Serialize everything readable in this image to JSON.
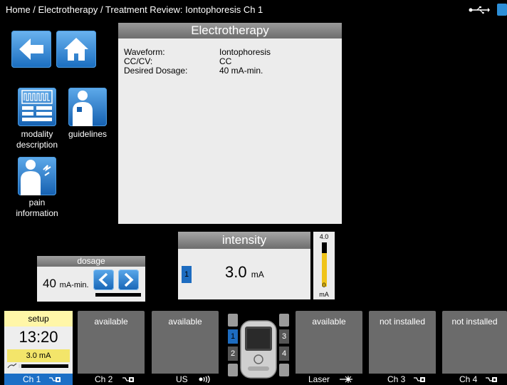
{
  "header": {
    "breadcrumb": "Home / Electrotherapy / Treatment Review: Iontophoresis Ch 1",
    "usb_icon": "usb-icon",
    "battery_icon": "battery-icon"
  },
  "nav": {
    "back_icon": "arrow-left-icon",
    "home_icon": "house-icon"
  },
  "tiles": [
    {
      "label_line1": "modality",
      "label_line2": "description",
      "icon": "waveform-icon"
    },
    {
      "label_line1": "guidelines",
      "label_line2": "",
      "icon": "body-electrode-icon"
    },
    {
      "label_line1": "pain",
      "label_line2": "information",
      "icon": "body-pain-icon"
    }
  ],
  "electrotherapy": {
    "title": "Electrotherapy",
    "params": [
      {
        "label": "Waveform:",
        "value": "Iontophoresis"
      },
      {
        "label": "CC/CV:",
        "value": "CC"
      },
      {
        "label": "Desired Dosage:",
        "value": "40 mA-min."
      }
    ]
  },
  "intensity": {
    "title": "intensity",
    "channel": "1",
    "value": "3.0",
    "unit": "mA",
    "gauge_max": "4.0",
    "gauge_min": "0",
    "gauge_unit": "mA",
    "gauge_fraction": 0.75
  },
  "dosage": {
    "title": "dosage",
    "value": "40",
    "unit": "mA-min.",
    "prev_icon": "chevron-left-icon",
    "next_icon": "chevron-right-icon"
  },
  "channels": [
    {
      "status": "setup",
      "time": "13:20",
      "current": "3.0 mA",
      "label": "Ch 1",
      "icon": "electrode-icon",
      "progress": 0.05
    },
    {
      "status": "available",
      "label": "Ch 2",
      "icon": "electrode-icon"
    },
    {
      "status": "available",
      "label": "US",
      "icon": "ultrasound-icon"
    },
    {
      "status": "available",
      "label": "Laser",
      "icon": "laser-icon"
    },
    {
      "status": "not installed",
      "label": "Ch 3",
      "icon": "electrode-icon"
    },
    {
      "status": "not installed",
      "label": "Ch 4",
      "icon": "electrode-icon"
    }
  ],
  "device": {
    "slots": [
      "1",
      "2",
      "3",
      "4"
    ],
    "icon": "device-icon"
  }
}
